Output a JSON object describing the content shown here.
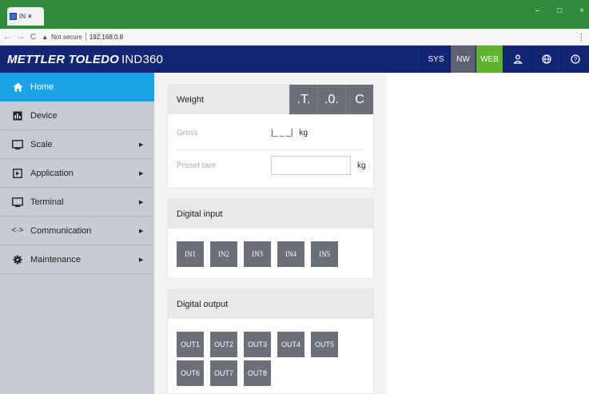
{
  "browser": {
    "tab_title": "IN",
    "tab_close": "×",
    "url_warning": "Not secure",
    "url": "192.168.0.8",
    "window_controls": [
      "–",
      "□",
      "×"
    ],
    "menu": "⋮"
  },
  "header": {
    "brand_bold": "METTLER TOLEDO",
    "brand_model": "IND360",
    "buttons": [
      "SYS",
      "NW",
      "WEB"
    ],
    "icons": [
      "user-icon",
      "globe-icon",
      "help-icon"
    ]
  },
  "sidebar": {
    "items": [
      {
        "label": "Home",
        "icon": "home-icon",
        "active": true,
        "arrow": false
      },
      {
        "label": "Device",
        "icon": "device-icon",
        "active": false,
        "arrow": false
      },
      {
        "label": "Scale",
        "icon": "scale-icon",
        "active": false,
        "arrow": true
      },
      {
        "label": "Application",
        "icon": "application-icon",
        "active": false,
        "arrow": true
      },
      {
        "label": "Terminal",
        "icon": "terminal-icon",
        "active": false,
        "arrow": true
      },
      {
        "label": "Communication",
        "icon": "communication-icon",
        "active": false,
        "arrow": true
      },
      {
        "label": "Maintenance",
        "icon": "gear-icon",
        "active": false,
        "arrow": true
      }
    ]
  },
  "weight": {
    "title": "Weight",
    "buttons": [
      ".T.",
      ".0.",
      "C"
    ],
    "gross_label": "Gross",
    "gross_value": "|_ _ _|",
    "gross_unit": "kg",
    "tare_label": "Preset tare",
    "tare_value": "",
    "tare_unit": "kg"
  },
  "digital_input": {
    "title": "Digital input",
    "buttons": [
      "IN1",
      "IN2",
      "IN3",
      "IN4",
      "IN5"
    ]
  },
  "digital_output": {
    "title": "Digital output",
    "row1": [
      "OUT1",
      "OUT2",
      "OUT3",
      "OUT4",
      "OUT5"
    ],
    "row2": [
      "OUT6",
      "OUT7",
      "OUT8"
    ]
  },
  "colors": {
    "header_bg": "#132676",
    "sidebar_bg": "#c7cbd3",
    "active_item": "#1aa3e6",
    "web_button": "#5fb22c",
    "nw_button": "#5d6272",
    "button_gray": "#6d6f78"
  }
}
